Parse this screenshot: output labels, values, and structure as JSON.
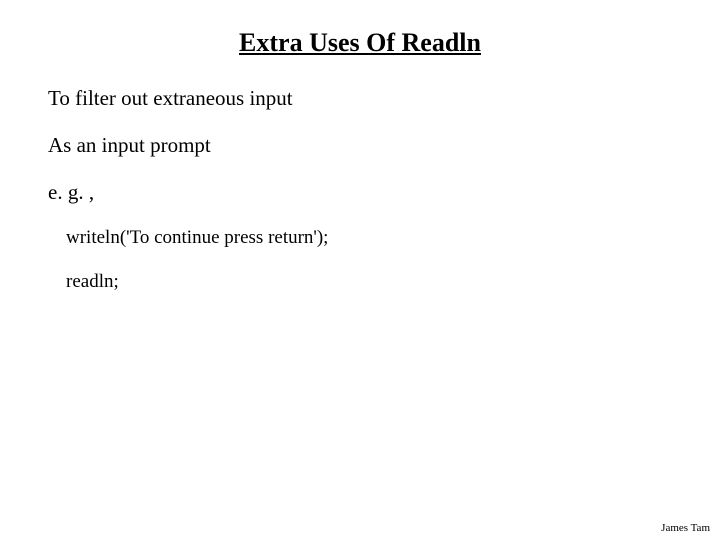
{
  "title": "Extra Uses Of Readln",
  "lines": {
    "l1": "To filter out extraneous input",
    "l2": "As an input prompt",
    "l3": "e. g. ,",
    "c1": "writeln('To continue press return');",
    "c2": "readln;"
  },
  "footer": "James Tam"
}
